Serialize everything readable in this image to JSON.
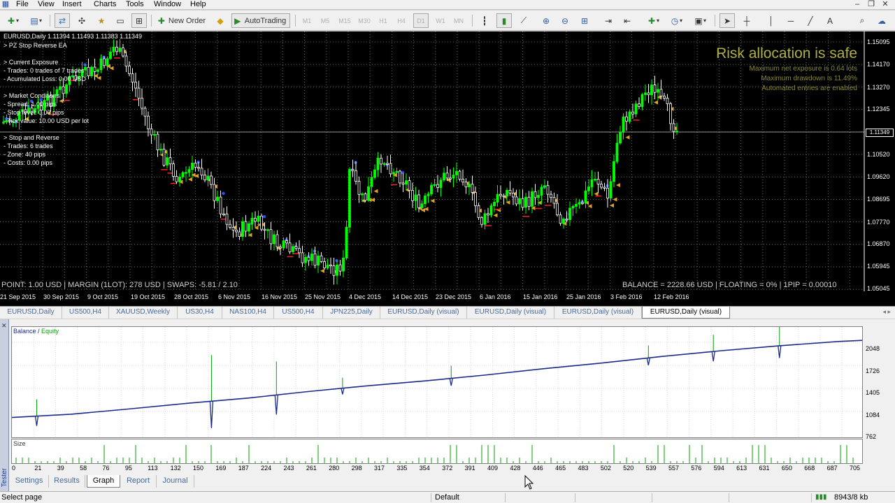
{
  "menu": [
    "File",
    "View",
    "Insert",
    "Charts",
    "Tools",
    "Window",
    "Help"
  ],
  "toolbar": {
    "new_order": "New Order",
    "auto_trading": "AutoTrading",
    "timeframes": [
      "M1",
      "M5",
      "M15",
      "M30",
      "H1",
      "H4",
      "D1",
      "W1",
      "MN"
    ]
  },
  "chart": {
    "header": "EURUSD,Daily  1.11394 1.11493 1.11383 1.11349",
    "ea_info": [
      "> PZ Stop Reverse EA",
      "",
      "> Current Exposure",
      "- Trades: 0 trades of 7 trades",
      "- Acumulated Loss: 0.00 USD",
      "",
      "> Market Conditions",
      "- Spread: 1.00 pips",
      "- Stop level: 0.00 pips",
      "- Tick value: 10.00 USD per lot",
      "",
      "> Stop and Reverse",
      "- Trades: 6 trades",
      "- Zone: 40 pips",
      "- Costs: 0.00 pips"
    ],
    "risk_title": "Risk allocation is safe",
    "risk_lines": [
      "Maximum net exposure is 0.64 lots",
      "Maximum drawdown is 11.49%",
      "Automated entries are enabled"
    ],
    "point_line": "POINT: 1.00 USD | MARGIN (1LOT): 278 USD | SWAPS: -5.81 / 2.10",
    "balance_line": "BALANCE = 2228.66 USD | FLOATING = 0% | 1PIP = 0.00010",
    "prices": [
      "1.15095",
      "1.14170",
      "1.13270",
      "1.12345",
      "1.11349",
      "1.10520",
      "1.09620",
      "1.08695",
      "1.07770",
      "1.06870",
      "1.05945",
      "1.05045"
    ],
    "current_price": "1.11349",
    "dates": [
      "21 Sep 2015",
      "30 Sep 2015",
      "9 Oct 2015",
      "19 Oct 2015",
      "28 Oct 2015",
      "6 Nov 2015",
      "16 Nov 2015",
      "25 Nov 2015",
      "4 Dec 2015",
      "14 Dec 2015",
      "23 Dec 2015",
      "6 Jan 2016",
      "15 Jan 2016",
      "25 Jan 2016",
      "3 Feb 2016",
      "12 Feb 2016"
    ],
    "colors": {
      "background": "#000000",
      "bull": "#00ff00",
      "bear": "#ffffff",
      "grid": "#6a6a6a",
      "risk": "#b0b040"
    }
  },
  "chart_tabs": [
    "EURUSD,Daily",
    "US500,H4",
    "XAUUSD,Weekly",
    "US30,H4",
    "NAS100,H4",
    "US500,H4",
    "JPN225,Daily",
    "EURUSD,Daily (visual)",
    "EURUSD,Daily (visual)",
    "EURUSD,Daily (visual)",
    "EURUSD,Daily (visual)"
  ],
  "active_chart_tab": 10,
  "tester": {
    "strip_label": "Tester",
    "graph_label_balance": "Balance",
    "graph_label_sep": " / ",
    "graph_label_equity": "Equity",
    "size_label": "Size",
    "y_labels": [
      "2048",
      "1726",
      "1405",
      "1084",
      "762"
    ],
    "x_labels": [
      "0",
      "21",
      "39",
      "58",
      "76",
      "95",
      "113",
      "132",
      "150",
      "169",
      "187",
      "224",
      "243",
      "261",
      "280",
      "298",
      "317",
      "335",
      "354",
      "372",
      "391",
      "409",
      "428",
      "446",
      "465",
      "483",
      "502",
      "520",
      "539",
      "557",
      "576",
      "594",
      "613",
      "631",
      "650",
      "668",
      "687",
      "705"
    ],
    "tabs": [
      "Settings",
      "Results",
      "Graph",
      "Report",
      "Journal"
    ],
    "active_tab": 2,
    "colors": {
      "balance": "#1a2a8a",
      "equity": "#00a000"
    }
  },
  "chart_data": {
    "type": "line",
    "title": "",
    "xlabel": "",
    "ylabel": "",
    "xlim": [
      0,
      720
    ],
    "ylim": [
      762,
      2048
    ],
    "grid": true,
    "x": [
      0,
      50,
      100,
      150,
      200,
      250,
      300,
      350,
      400,
      450,
      500,
      550,
      600,
      650,
      700,
      720
    ],
    "series": [
      {
        "name": "Balance",
        "values": [
          1000,
          1045,
          1120,
          1200,
          1270,
          1360,
          1440,
          1510,
          1590,
          1680,
          1760,
          1850,
          1930,
          2000,
          2060,
          2075
        ]
      }
    ]
  },
  "status": {
    "left": "Select page",
    "profile": "Default",
    "traffic": "8943/8 kb"
  }
}
